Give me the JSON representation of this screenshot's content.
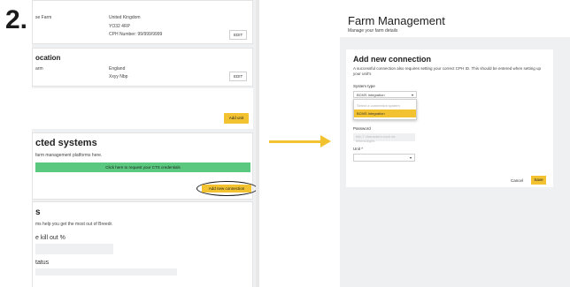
{
  "step_number": "2.",
  "left": {
    "farm_card": {
      "label": "se Farm",
      "country": "United Kingdom",
      "postcode": "YO32 4RP",
      "cph": "CPH Number: 99/999/9999",
      "edit": "EDIT"
    },
    "location_card": {
      "title": "ocation",
      "label": "arm",
      "country": "England",
      "name": "Xxyy Nbp",
      "edit": "EDIT"
    },
    "add_unit": "Add unit",
    "connected": {
      "title": "cted systems",
      "desc": "farm management platforms here.",
      "cts_button": "Click here to request your CTS credentials",
      "add_connection": "Add new connection"
    },
    "goals": {
      "title": "s",
      "desc": "ms help you get the most out of Breedr.",
      "kill_out": "e kill out %",
      "status": "tatus"
    }
  },
  "right": {
    "title": "Farm Management",
    "subtitle": "Manage your farm details",
    "modal": {
      "title": "Add new connection",
      "description": "A successful connection also requires setting your correct CPH ID. This should be entered when setting up your unit's",
      "system_type_label": "System type",
      "system_type_value": "BCMS Integration",
      "options": [
        "Select a connection system",
        "BCMS Integration"
      ],
      "password_label": "Password",
      "password_placeholder": "min 7 characters such as letters/digits",
      "unit_label": "Unit *",
      "cancel": "Cancel",
      "save": "Save"
    }
  },
  "colors": {
    "accent": "#f2c230",
    "green": "#5ac97f"
  }
}
